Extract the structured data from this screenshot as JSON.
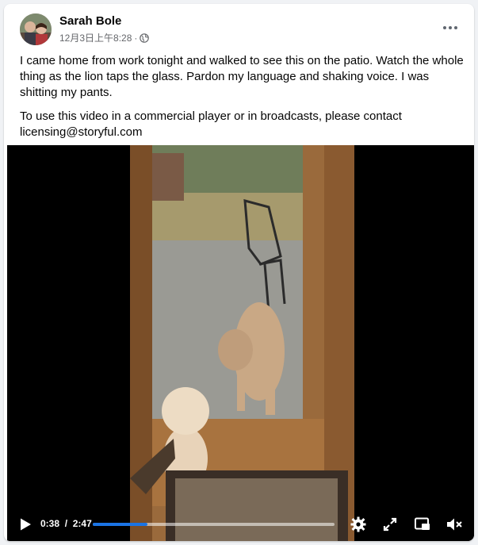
{
  "post": {
    "author": "Sarah Bole",
    "timestamp": "12月3日上午8:28",
    "separator": "·",
    "visibility_icon": "globe-icon",
    "more_icon": "more-options-icon",
    "paragraph_1": "I came home from work tonight and walked to see this on the patio. Watch the whole thing as the lion taps the glass. Pardon my language and shaking voice. I was shitting my pants.",
    "paragraph_2": "To use this video in a commercial player or in broadcasts, please contact licensing@storyful.com"
  },
  "video": {
    "current_time": "0:38",
    "duration": "2:47",
    "time_display": "0:38 / 2:47",
    "progress_fraction": 0.227,
    "icons": [
      "play-icon",
      "gear-icon",
      "fullscreen-icon",
      "picture-in-picture-icon",
      "mute-icon"
    ]
  },
  "colors": {
    "accent": "#1b74e4",
    "background": "#f0f2f5",
    "text_secondary": "#65676b"
  }
}
